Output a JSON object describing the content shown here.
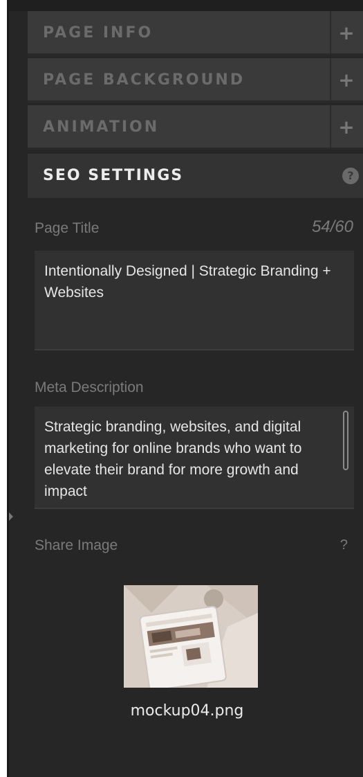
{
  "sections": {
    "page_info": {
      "label": "PAGE INFO",
      "toggle": "+"
    },
    "page_background": {
      "label": "PAGE BACKGROUND",
      "toggle": "+"
    },
    "animation": {
      "label": "ANIMATION",
      "toggle": "+"
    },
    "seo_settings": {
      "label": "SEO SETTINGS",
      "help": "?"
    }
  },
  "seo": {
    "page_title_label": "Page Title",
    "page_title_counter": "54/60",
    "page_title_value": "Intentionally Designed | Strategic Branding + Websites",
    "meta_description_label": "Meta Description",
    "meta_description_value": "Strategic branding, websites, and digital marketing for online brands who want to elevate their brand for more growth and impact",
    "share_image_label": "Share Image",
    "share_image_help": "?",
    "share_image_filename": "mockup04.png"
  },
  "icons": {
    "expand": "plus-icon",
    "help": "help-circle-icon",
    "thumbnail": "image-thumbnail"
  },
  "colors": {
    "panel_bg": "#262626",
    "header_bg": "#3a3a3a",
    "active_header_bg": "#333333",
    "text_muted": "#7a7a7a",
    "text_bright": "#e6e6e6"
  }
}
